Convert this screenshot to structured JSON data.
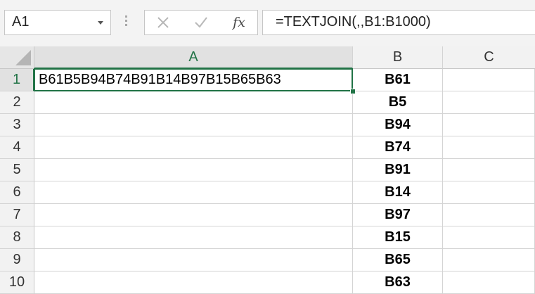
{
  "name_box": {
    "value": "A1"
  },
  "formula_bar": {
    "cancel_icon": "x-icon",
    "enter_icon": "check-icon",
    "insert_function_label": "fx",
    "formula": "=TEXTJOIN(,,B1:B1000)"
  },
  "columns": [
    {
      "label": "A",
      "selected": true
    },
    {
      "label": "B",
      "selected": false
    },
    {
      "label": "C",
      "selected": false
    }
  ],
  "rows": [
    {
      "number": "1",
      "a": "B61B5B94B74B91B14B97B15B65B63",
      "b": "B61",
      "c": ""
    },
    {
      "number": "2",
      "a": "",
      "b": "B5",
      "c": ""
    },
    {
      "number": "3",
      "a": "",
      "b": "B94",
      "c": ""
    },
    {
      "number": "4",
      "a": "",
      "b": "B74",
      "c": ""
    },
    {
      "number": "5",
      "a": "",
      "b": "B91",
      "c": ""
    },
    {
      "number": "6",
      "a": "",
      "b": "B14",
      "c": ""
    },
    {
      "number": "7",
      "a": "",
      "b": "B97",
      "c": ""
    },
    {
      "number": "8",
      "a": "",
      "b": "B15",
      "c": ""
    },
    {
      "number": "9",
      "a": "",
      "b": "B65",
      "c": ""
    },
    {
      "number": "10",
      "a": "",
      "b": "B63",
      "c": ""
    }
  ],
  "active_cell": "A1",
  "accent_color": "#217346"
}
